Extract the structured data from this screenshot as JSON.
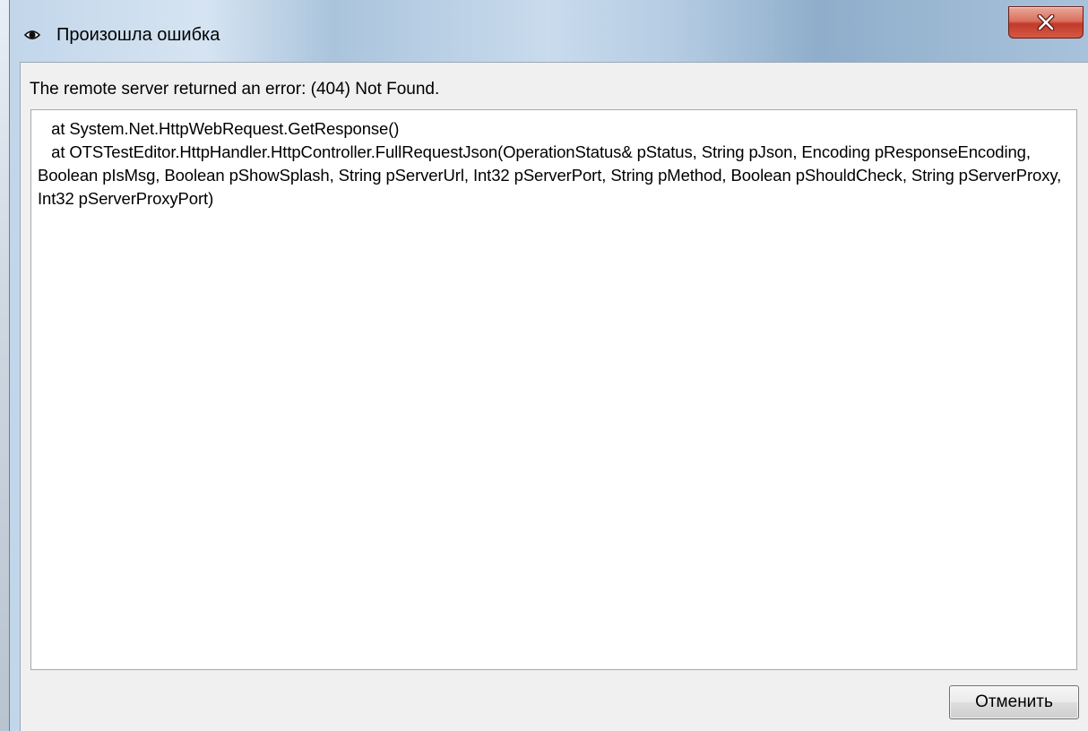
{
  "window": {
    "title": "Произошла ошибка",
    "title_icon": "error-eye-icon",
    "close_icon": "close-icon"
  },
  "error": {
    "message": "The remote server returned an error: (404) Not Found.",
    "details": "   at System.Net.HttpWebRequest.GetResponse()\n   at OTSTestEditor.HttpHandler.HttpController.FullRequestJson(OperationStatus& pStatus, String pJson, Encoding pResponseEncoding, Boolean pIsMsg, Boolean pShowSplash, String pServerUrl, Int32 pServerPort, String pMethod, Boolean pShouldCheck, String pServerProxy, Int32 pServerProxyPort)"
  },
  "buttons": {
    "cancel_label": "Отменить"
  },
  "colors": {
    "close_button": "#c2392a",
    "client_background": "#f0f0f0",
    "titlebar": "#b4cbe2"
  }
}
